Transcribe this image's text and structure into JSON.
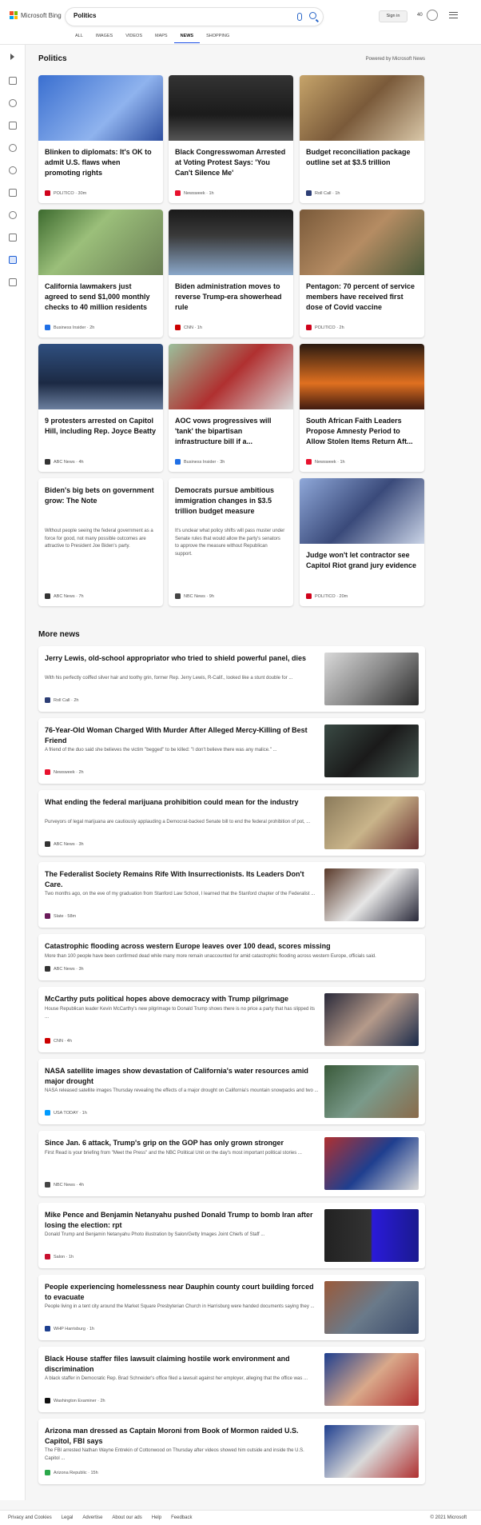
{
  "header": {
    "logo_text": "Microsoft Bing",
    "search_query": "Politics",
    "nav": [
      "ALL",
      "IMAGES",
      "VIDEOS",
      "MAPS",
      "NEWS",
      "SHOPPING"
    ],
    "active_nav": "NEWS",
    "signin_label": "Sign in",
    "points": "40"
  },
  "politics": {
    "title": "Politics",
    "powered_by": "Powered by Microsoft News",
    "cards": [
      {
        "title": "Blinken to diplomats: It's OK to admit U.S. flaws when promoting rights",
        "source": "POLITICO",
        "time": "30m",
        "src_color": "#d0021b"
      },
      {
        "title": "Black Congresswoman Arrested at Voting Protest Says: 'You Can't Silence Me'",
        "source": "Newsweek",
        "time": "1h",
        "src_color": "#e8112d"
      },
      {
        "title": "Budget reconciliation package outline set at $3.5 trillion",
        "source": "Roll Call",
        "time": "1h",
        "src_color": "#2d3e75"
      },
      {
        "title": "California lawmakers just agreed to send $1,000 monthly checks to 40 million residents",
        "source": "Business Insider",
        "time": "2h",
        "src_color": "#1f6fe5"
      },
      {
        "title": "Biden administration moves to reverse Trump-era showerhead rule",
        "source": "CNN",
        "time": "1h",
        "src_color": "#cc0000"
      },
      {
        "title": "Pentagon: 70 percent of service members have received first dose of Covid vaccine",
        "source": "POLITICO",
        "time": "2h",
        "src_color": "#d0021b"
      },
      {
        "title": "9 protesters arrested on Capitol Hill, including Rep. Joyce Beatty",
        "source": "ABC News",
        "time": "4h",
        "src_color": "#333333"
      },
      {
        "title": "AOC vows progressives will 'tank' the bipartisan infrastructure bill if a...",
        "source": "Business Insider",
        "time": "3h",
        "src_color": "#1f6fe5"
      },
      {
        "title": "South African Faith Leaders Propose Amnesty Period to Allow Stolen Items Return Aft...",
        "source": "Newsweek",
        "time": "1h",
        "src_color": "#e8112d"
      },
      {
        "title": "Biden's big bets on government grow: The Note",
        "body": "Without people seeing the federal government as a force for good, not many possible outcomes are attractive to President Joe Biden's party.",
        "source": "ABC News",
        "time": "7h",
        "src_color": "#333333"
      },
      {
        "title": "Democrats pursue ambitious immigration changes in $3.5 trillion budget measure",
        "body": "It's unclear what policy shifts will pass muster under Senate rules that would allow the party's senators to approve the measure without Republican support.",
        "source": "NBC News",
        "time": "9h",
        "src_color": "#444444"
      },
      {
        "title": "Judge won't let contractor see Capitol Riot grand jury evidence",
        "source": "POLITICO",
        "time": "20m",
        "src_color": "#d0021b"
      }
    ]
  },
  "more_news": {
    "title": "More news",
    "items": [
      {
        "title": "Jerry Lewis, old-school appropriator who tried to shield powerful panel, dies",
        "snippet": "With his perfectly coiffed silver hair and toothy grin, former Rep. Jerry Lewis, R-Calif., looked like a stunt double for ...",
        "source": "Roll Call",
        "time": "2h",
        "src_color": "#2d3e75"
      },
      {
        "title": "76-Year-Old Woman Charged With Murder After Alleged Mercy-Killing of Best Friend",
        "snippet": "A friend of the duo said she believes the victim \"begged\" to be killed: \"I don't believe there was any malice.\" ...",
        "source": "Newsweek",
        "time": "2h",
        "src_color": "#e8112d"
      },
      {
        "title": "What ending the federal marijuana prohibition could mean for the industry",
        "snippet": "Purveyors of legal marijuana are cautiously applauding a Democrat-backed Senate bill to end the federal prohibition of pot, ...",
        "source": "ABC News",
        "time": "3h",
        "src_color": "#333333"
      },
      {
        "title": "The Federalist Society Remains Rife With Insurrectionists. Its Leaders Don't Care.",
        "snippet": "Two months ago, on the eve of my graduation from Stanford Law School, I learned that the Stanford chapter of the Federalist ...",
        "source": "Slate",
        "time": "58m",
        "src_color": "#6a1b5a"
      },
      {
        "title": "Catastrophic flooding across western Europe leaves over 100 dead, scores missing",
        "snippet": "More than 100 people have been confirmed dead while many more remain unaccounted for amid catastrophic flooding across western Europe, officials said.",
        "source": "ABC News",
        "time": "3h",
        "src_color": "#333333"
      },
      {
        "title": "McCarthy puts political hopes above democracy with Trump pilgrimage",
        "snippet": "House Republican leader Kevin McCarthy's new pilgrimage to Donald Trump shows there is no price a party that has slipped its ...",
        "source": "CNN",
        "time": "4h",
        "src_color": "#cc0000"
      },
      {
        "title": "NASA satellite images show devastation of California's water resources amid major drought",
        "snippet": "NASA released satellite images Thursday revealing the effects of a major drought on California's mountain snowpacks and two ...",
        "source": "USA TODAY",
        "time": "1h",
        "src_color": "#009bff"
      },
      {
        "title": "Since Jan. 6 attack, Trump's grip on the GOP has only grown stronger",
        "snippet": "First Read is your briefing from \"Meet the Press\" and the NBC Political Unit on the day's most important political stories ...",
        "source": "NBC News",
        "time": "4h",
        "src_color": "#444444"
      },
      {
        "title": "Mike Pence and Benjamin Netanyahu pushed Donald Trump to bomb Iran after losing the election: rpt",
        "snippet": "Donald Trump and Benjamin Netanyahu Photo illustration by Salon/Getty Images Joint Chiefs of Staff ...",
        "source": "Salon",
        "time": "1h",
        "src_color": "#c8102e"
      },
      {
        "title": "People experiencing homelessness near Dauphin county court building forced to evacuate",
        "snippet": "People living in a tent city around the Market Square Presbyterian Church in Harrisburg were handed documents saying they ...",
        "source": "WHP Harrisburg",
        "time": "1h",
        "src_color": "#1d3f8f"
      },
      {
        "title": "Black House staffer files lawsuit claiming hostile work environment and discrimination",
        "snippet": "A black staffer in Democratic Rep. Brad Schneider's office filed a lawsuit against her employer, alleging that the office was ...",
        "source": "Washington Examiner",
        "time": "2h",
        "src_color": "#111111"
      },
      {
        "title": "Arizona man dressed as Captain Moroni from Book of Mormon raided U.S. Capitol, FBI says",
        "snippet": "The FBI arrested Nathan Wayne Entrekin of Cottonwood on Thursday after videos showed him outside and inside the U.S. Capitol ...",
        "source": "Arizona Republic",
        "time": "15h",
        "src_color": "#2aa84a"
      }
    ]
  },
  "footer": {
    "links": [
      "Privacy and Cookies",
      "Legal",
      "Advertise",
      "About our ads",
      "Help",
      "Feedback"
    ],
    "copyright": "© 2021 Microsoft"
  },
  "meta_separator": "·",
  "icons": [
    "microsoft-logo-icon",
    "mic-icon",
    "search-icon",
    "rewards-icon",
    "menu-icon",
    "expand-arrow-icon",
    "home-icon",
    "sports-icon",
    "flag-icon",
    "location-icon",
    "globe-icon",
    "science-icon",
    "rocket-icon",
    "video-icon",
    "politics-icon",
    "money-icon"
  ]
}
